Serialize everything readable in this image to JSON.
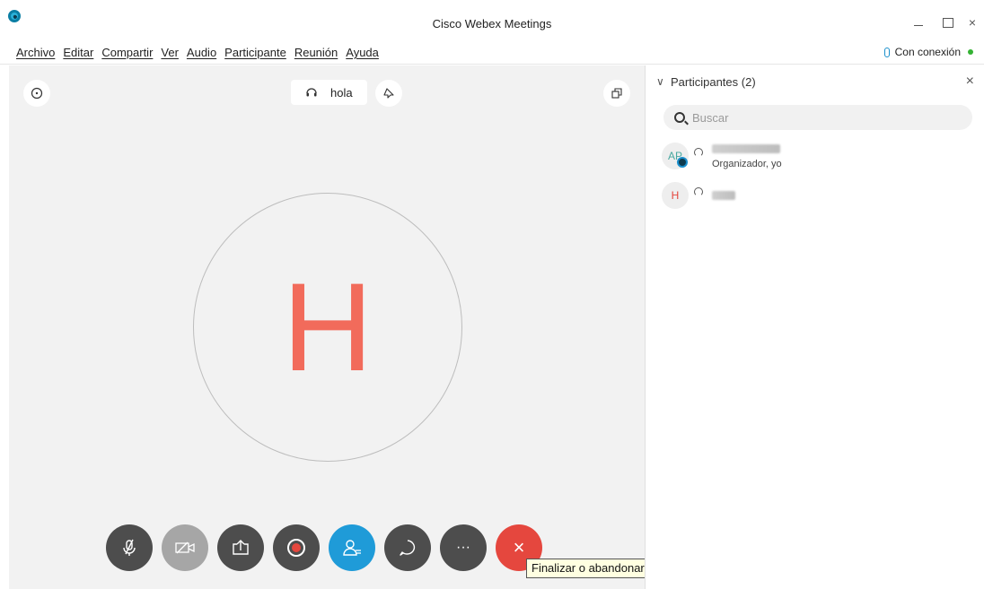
{
  "window": {
    "title": "Cisco Webex Meetings",
    "minimize": "–",
    "maximize": "□",
    "close": "×"
  },
  "menu": {
    "items": [
      "Archivo",
      "Editar",
      "Compartir",
      "Ver",
      "Audio",
      "Participante",
      "Reunión",
      "Ayuda"
    ],
    "connection_status": "Con conexión"
  },
  "stage": {
    "speaker_name": "hola",
    "active_initial": "H"
  },
  "controls": {
    "tooltip": "Finalizar o abandonar reunión",
    "more_label": "···",
    "end_label": "×"
  },
  "panel": {
    "title": "Participantes (2)",
    "close": "×",
    "chevron": "∨",
    "search_placeholder": "Buscar",
    "participants": [
      {
        "initials": "AP",
        "role": "Organizador, yo"
      },
      {
        "initials": "H",
        "role": ""
      }
    ]
  },
  "colors": {
    "accent": "#1f9bd8",
    "end_call": "#e5473e",
    "initial_color": "#f26b5b",
    "online_dot": "#34b233"
  }
}
